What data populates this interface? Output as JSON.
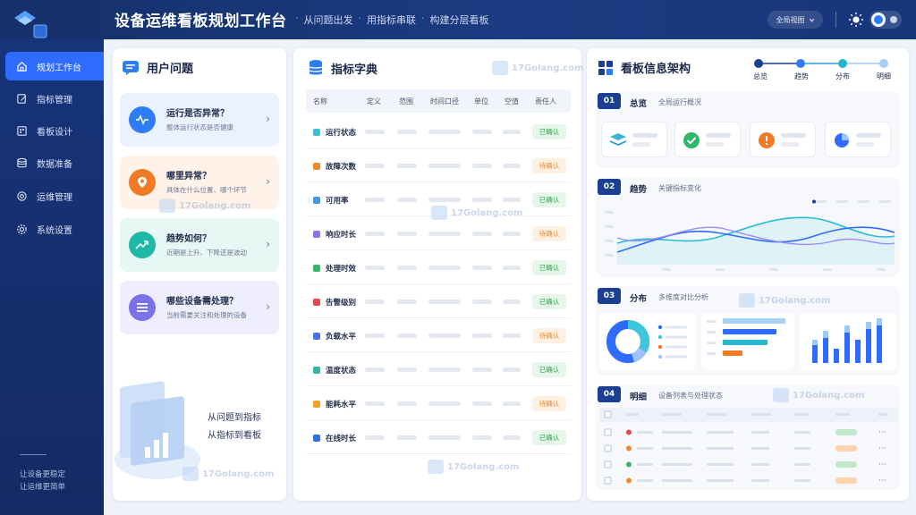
{
  "header": {
    "title": "设备运维看板规划工作台",
    "subtitle": [
      "从问题出发",
      "用指标串联",
      "构建分层看板"
    ],
    "view_label": "全局视图"
  },
  "sidebar": {
    "items": [
      {
        "label": "规划工作台",
        "icon": "home-icon"
      },
      {
        "label": "指标管理",
        "icon": "edit-icon"
      },
      {
        "label": "看板设计",
        "icon": "board-icon"
      },
      {
        "label": "数据准备",
        "icon": "database-icon"
      },
      {
        "label": "运维管理",
        "icon": "target-icon"
      },
      {
        "label": "系统设置",
        "icon": "gear-icon"
      }
    ],
    "footer": [
      "让设备更稳定",
      "让运维更简单"
    ]
  },
  "questions": {
    "title": "用户问题",
    "items": [
      {
        "title": "运行是否异常？",
        "sub": "整体运行状态是否健康",
        "color": "#2f7df6",
        "bg": "#eaf2ff"
      },
      {
        "title": "哪里异常？",
        "sub": "具体在什么位置、哪个环节",
        "color": "#f07a26",
        "bg": "#fff2e8"
      },
      {
        "title": "趋势如何？",
        "sub": "近期是上升、下降还是波动",
        "color": "#1db8a6",
        "bg": "#e6f7f4"
      },
      {
        "title": "哪些设备需处理？",
        "sub": "当前需要关注和处理的设备",
        "color": "#7a72ea",
        "bg": "#efeefc"
      }
    ],
    "flow": [
      "从问题到指标",
      "从指标到看板"
    ]
  },
  "dictionary": {
    "title": "指标字典",
    "headers": [
      "名称",
      "定义",
      "范围",
      "时间口径",
      "单位",
      "空值",
      "责任人"
    ],
    "rows": [
      {
        "name": "运行状态",
        "color": "#3fc0d8",
        "status": "已确认",
        "type": "ok"
      },
      {
        "name": "故障次数",
        "color": "#f08a2b",
        "status": "待确认",
        "type": "wait"
      },
      {
        "name": "可用率",
        "color": "#3d9cf0",
        "status": "已确认",
        "type": "ok"
      },
      {
        "name": "响应时长",
        "color": "#8e6ff0",
        "status": "待确认",
        "type": "wait"
      },
      {
        "name": "处理时效",
        "color": "#35b86a",
        "status": "已确认",
        "type": "ok"
      },
      {
        "name": "告警级别",
        "color": "#e8474c",
        "status": "已确认",
        "type": "ok"
      },
      {
        "name": "负载水平",
        "color": "#4e6ef2",
        "status": "待确认",
        "type": "wait"
      },
      {
        "name": "温度状态",
        "color": "#2fb9a4",
        "status": "已确认",
        "type": "ok"
      },
      {
        "name": "能耗水平",
        "color": "#f2a32e",
        "status": "待确认",
        "type": "wait"
      },
      {
        "name": "在线时长",
        "color": "#3070e8",
        "status": "已确认",
        "type": "ok"
      }
    ]
  },
  "architecture": {
    "title": "看板信息架构",
    "steps": [
      "总览",
      "趋势",
      "分布",
      "明细"
    ],
    "sections": [
      {
        "num": "01",
        "title": "总览",
        "sub": "全局运行概况"
      },
      {
        "num": "02",
        "title": "趋势",
        "sub": "关键指标变化"
      },
      {
        "num": "03",
        "title": "分布",
        "sub": "多维度对比分析"
      },
      {
        "num": "04",
        "title": "明细",
        "sub": "设备列表与处理状态"
      }
    ]
  },
  "watermark": "17Golang.com"
}
